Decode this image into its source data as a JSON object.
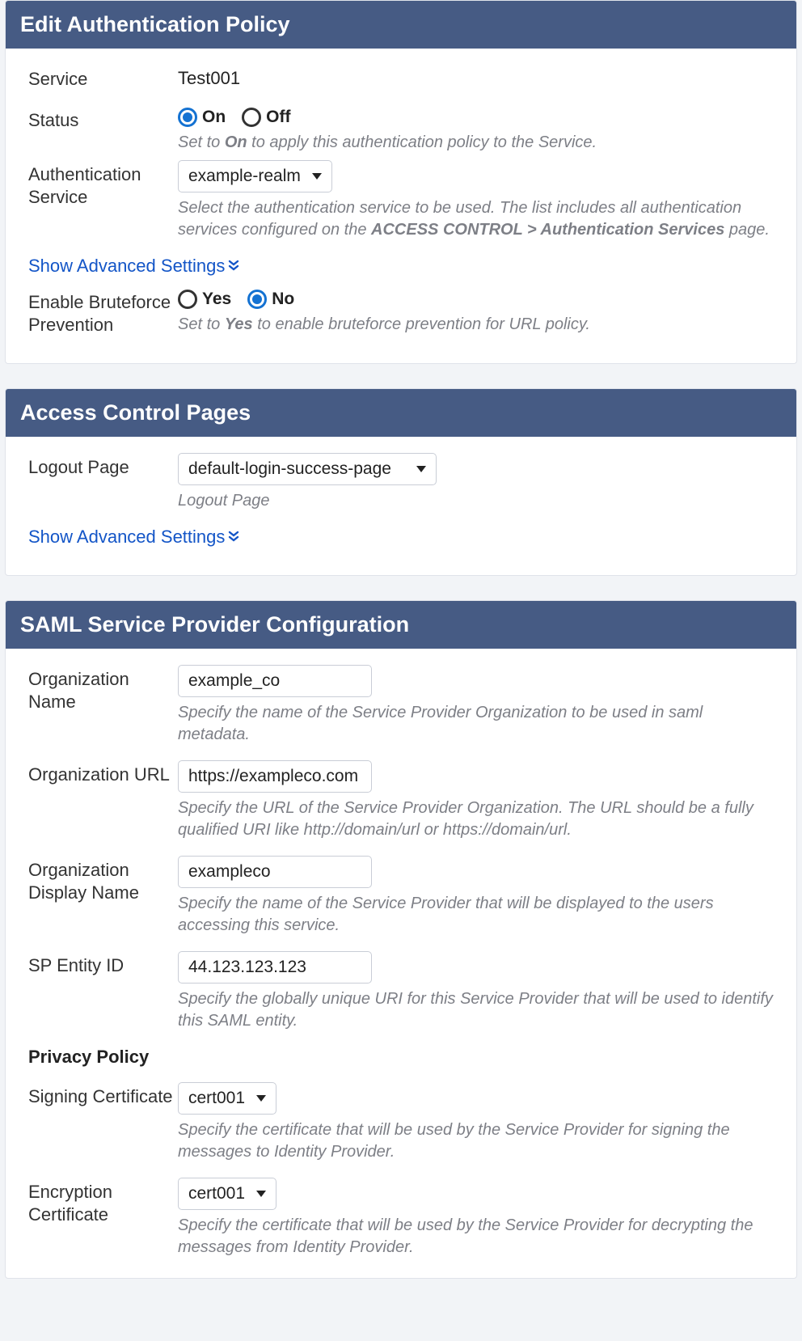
{
  "panel1": {
    "title": "Edit Authentication Policy",
    "fields": {
      "service_label": "Service",
      "service_value": "Test001",
      "status_label": "Status",
      "status_radios": {
        "on": "On",
        "off": "Off",
        "selected": "on"
      },
      "status_help_pre": "Set to ",
      "status_help_em": "On",
      "status_help_post": " to apply this authentication policy to the Service.",
      "auth_service_label": "Authentication Service",
      "auth_service_value": "example-realm",
      "auth_service_help_pre": "Select the authentication service to be used. The list includes all authentication services configured on the ",
      "auth_service_help_em": "ACCESS CONTROL > Authentication Services",
      "auth_service_help_post": " page.",
      "adv_link": "Show Advanced Settings",
      "brute_label": "Enable Bruteforce Prevention",
      "brute_radios": {
        "yes": "Yes",
        "no": "No",
        "selected": "no"
      },
      "brute_help_pre": "Set to ",
      "brute_help_em": "Yes",
      "brute_help_post": " to enable bruteforce prevention for URL policy."
    }
  },
  "panel2": {
    "title": "Access Control Pages",
    "fields": {
      "logout_label": "Logout Page",
      "logout_value": "default-login-success-page",
      "logout_help": "Logout Page",
      "adv_link": "Show Advanced Settings"
    }
  },
  "panel3": {
    "title": "SAML Service Provider Configuration",
    "fields": {
      "org_name_label": "Organization Name",
      "org_name_value": "example_co",
      "org_name_help": "Specify the name of the Service Provider Organization to be used in saml metadata.",
      "org_url_label": "Organization URL",
      "org_url_value": "https://exampleco.com",
      "org_url_help": "Specify the URL of the Service Provider Organization. The URL should be a fully qualified URI like http://domain/url or https://domain/url.",
      "org_disp_label": "Organization Display Name",
      "org_disp_value": "exampleco",
      "org_disp_help": "Specify the name of the Service Provider that will be displayed to the users accessing this service.",
      "sp_entity_label": "SP Entity ID",
      "sp_entity_value": "44.123.123.123",
      "sp_entity_help": "Specify the globally unique URI for this Service Provider that will be used to identify this SAML entity.",
      "privacy_heading": "Privacy Policy",
      "sign_cert_label": "Signing Certificate",
      "sign_cert_value": "cert001",
      "sign_cert_help": "Specify the certificate that will be used by the Service Provider for signing the messages to Identity Provider.",
      "enc_cert_label": "Encryption Certificate",
      "enc_cert_value": "cert001",
      "enc_cert_help": "Specify the certificate that will be used by the Service Provider for decrypting the messages from Identity Provider."
    }
  }
}
